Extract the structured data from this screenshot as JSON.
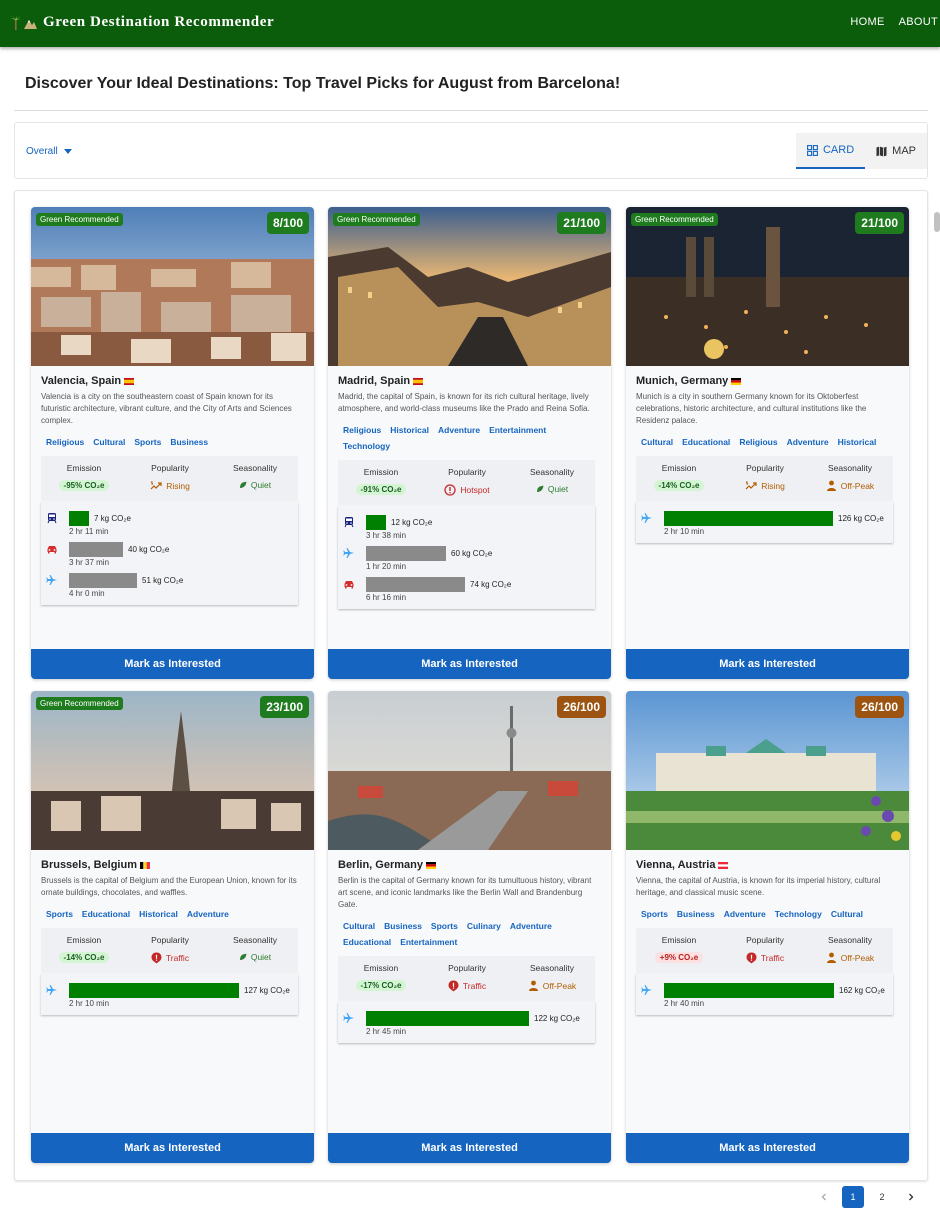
{
  "app": {
    "title": "Green Destination Recommender",
    "logo_icons": [
      "palm-tree-icon",
      "mountain-icon"
    ]
  },
  "nav": [
    {
      "label": "HOME"
    },
    {
      "label": "ABOUT"
    }
  ],
  "page": {
    "title_prefix": "Discover Your Ideal Destinations: Top Travel Picks for ",
    "month": "August",
    "title_mid": " from ",
    "origin": "Barcelona",
    "title_suffix": "!"
  },
  "filter": {
    "sort_value": "Overall",
    "views": [
      {
        "label": "CARD",
        "icon": "grid-icon",
        "active": true
      },
      {
        "label": "MAP",
        "icon": "map-icon",
        "active": false
      }
    ]
  },
  "labels": {
    "emission": "Emission",
    "popularity": "Popularity",
    "seasonality": "Seasonality",
    "green_badge": "Green Recommended",
    "mark_button": "Mark as Interested"
  },
  "colors": {
    "brand_green": "#0b5c0b",
    "accent_blue": "#1565c0",
    "score_green": "#1e7b1e",
    "score_brown": "#9c5410",
    "bar_green": "#008000",
    "bar_grey": "#8a8a8a"
  },
  "destinations": [
    {
      "city": "Valencia, Spain",
      "flag": "spain",
      "score": "8/100",
      "green": true,
      "description": "Valencia is a city on the southeastern coast of Spain known for its futuristic architecture, vibrant culture, and the City of Arts and Sciences complex.",
      "tags": [
        "Religious",
        "Cultural",
        "Sports",
        "Business"
      ],
      "emission": {
        "text": "-95% CO₂e",
        "tone": "green"
      },
      "popularity": {
        "text": "Rising",
        "icon": "rising-icon",
        "tone": "orange"
      },
      "seasonality": {
        "text": "Quiet",
        "icon": "leaf-icon",
        "tone": "dgreen"
      },
      "transport": [
        {
          "mode": "train",
          "co2": 7,
          "co2_text": "7 kg CO₂e",
          "time": "2 hr 11 min",
          "green": true
        },
        {
          "mode": "car",
          "co2": 40,
          "co2_text": "40 kg CO₂e",
          "time": "3 hr 37 min",
          "green": false
        },
        {
          "mode": "plane",
          "co2": 51,
          "co2_text": "51 kg CO₂e",
          "time": "4 hr 0 min",
          "green": false
        }
      ]
    },
    {
      "city": "Madrid, Spain",
      "flag": "spain",
      "score": "21/100",
      "green": true,
      "description": "Madrid, the capital of Spain, is known for its rich cultural heritage, lively atmosphere, and world-class museums like the Prado and Reina Sofia.",
      "tags": [
        "Religious",
        "Historical",
        "Adventure",
        "Entertainment",
        "Technology"
      ],
      "emission": {
        "text": "-91% CO₂e",
        "tone": "green"
      },
      "popularity": {
        "text": "Hotspot",
        "icon": "alert-circle-icon",
        "tone": "dred"
      },
      "seasonality": {
        "text": "Quiet",
        "icon": "leaf-icon",
        "tone": "dgreen"
      },
      "transport": [
        {
          "mode": "train",
          "co2": 12,
          "co2_text": "12 kg CO₂e",
          "time": "3 hr 38 min",
          "green": true
        },
        {
          "mode": "plane",
          "co2": 60,
          "co2_text": "60 kg CO₂e",
          "time": "1 hr 20 min",
          "green": false
        },
        {
          "mode": "car",
          "co2": 74,
          "co2_text": "74 kg CO₂e",
          "time": "6 hr 16 min",
          "green": false
        }
      ]
    },
    {
      "city": "Munich, Germany",
      "flag": "germany",
      "score": "21/100",
      "green": true,
      "description": "Munich is a city in southern Germany known for its Oktoberfest celebrations, historic architecture, and cultural institutions like the Residenz palace.",
      "tags": [
        "Cultural",
        "Educational",
        "Religious",
        "Adventure",
        "Historical"
      ],
      "emission": {
        "text": "-14% CO₂e",
        "tone": "green"
      },
      "popularity": {
        "text": "Rising",
        "icon": "rising-icon",
        "tone": "orange"
      },
      "seasonality": {
        "text": "Off-Peak",
        "icon": "person-icon",
        "tone": "orange"
      },
      "transport": [
        {
          "mode": "plane",
          "co2": 126,
          "co2_text": "126 kg CO₂e",
          "time": "2 hr 10 min",
          "green": true
        }
      ]
    },
    {
      "city": "Brussels, Belgium",
      "flag": "belgium",
      "score": "23/100",
      "green": true,
      "description": "Brussels is the capital of Belgium and the European Union, known for its ornate buildings, chocolates, and waffles.",
      "tags": [
        "Sports",
        "Educational",
        "Historical",
        "Adventure"
      ],
      "emission": {
        "text": "-14% CO₂e",
        "tone": "green"
      },
      "popularity": {
        "text": "Traffic",
        "icon": "traffic-icon",
        "tone": "dred"
      },
      "seasonality": {
        "text": "Quiet",
        "icon": "leaf-icon",
        "tone": "dgreen"
      },
      "transport": [
        {
          "mode": "plane",
          "co2": 127,
          "co2_text": "127 kg CO₂e",
          "time": "2 hr 10 min",
          "green": true
        }
      ]
    },
    {
      "city": "Berlin, Germany",
      "flag": "germany",
      "score": "26/100",
      "green": false,
      "description": "Berlin is the capital of Germany known for its tumultuous history, vibrant art scene, and iconic landmarks like the Berlin Wall and Brandenburg Gate.",
      "tags": [
        "Cultural",
        "Business",
        "Sports",
        "Culinary",
        "Adventure",
        "Educational",
        "Entertainment"
      ],
      "emission": {
        "text": "-17% CO₂e",
        "tone": "green"
      },
      "popularity": {
        "text": "Traffic",
        "icon": "traffic-icon",
        "tone": "dred"
      },
      "seasonality": {
        "text": "Off-Peak",
        "icon": "person-icon",
        "tone": "orange"
      },
      "transport": [
        {
          "mode": "plane",
          "co2": 122,
          "co2_text": "122 kg CO₂e",
          "time": "2 hr 45 min",
          "green": true
        }
      ]
    },
    {
      "city": "Vienna, Austria",
      "flag": "austria",
      "score": "26/100",
      "green": false,
      "description": "Vienna, the capital of Austria, is known for its imperial history, cultural heritage, and classical music scene.",
      "tags": [
        "Sports",
        "Business",
        "Adventure",
        "Technology",
        "Cultural"
      ],
      "emission": {
        "text": "+9% CO₂e",
        "tone": "red"
      },
      "popularity": {
        "text": "Traffic",
        "icon": "traffic-icon",
        "tone": "dred"
      },
      "seasonality": {
        "text": "Off-Peak",
        "icon": "person-icon",
        "tone": "orange"
      },
      "transport": [
        {
          "mode": "plane",
          "co2": 162,
          "co2_text": "162 kg CO₂e",
          "time": "2 hr 40 min",
          "green": true
        }
      ]
    }
  ],
  "pagination": {
    "pages": [
      "1",
      "2"
    ],
    "current": "1",
    "prev_icon": "chevron-left-icon",
    "next_icon": "chevron-right-icon"
  }
}
